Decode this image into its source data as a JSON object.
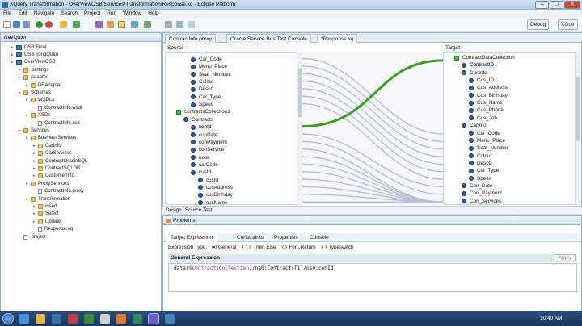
{
  "window": {
    "title": "XQuery Transformation - OverViewOSB/Services/Transformation/Response.xq - Eclipse Platform",
    "min": "–",
    "max": "□",
    "close": "X"
  },
  "menu": [
    "File",
    "Edit",
    "Navigate",
    "Search",
    "Project",
    "Run",
    "Window",
    "Help"
  ],
  "perspectives": {
    "debug": "Debug",
    "xquery": "XQue"
  },
  "navigator": {
    "tab": "Navigator",
    "items": [
      {
        "label": "OSB Final",
        "icon": "project"
      },
      {
        "label": "OSB TongQuan",
        "icon": "project"
      },
      {
        "label": "OverViewOSB",
        "icon": "project"
      },
      {
        "label": ".settings",
        "icon": "folder"
      },
      {
        "label": "Adapter",
        "icon": "folder"
      },
      {
        "label": "DBAdapter",
        "icon": "folder"
      },
      {
        "label": "Schemas",
        "icon": "folder"
      },
      {
        "label": "WSDLs",
        "icon": "folder"
      },
      {
        "label": "ContractInfo.wsdl",
        "icon": "file"
      },
      {
        "label": "XSDs",
        "icon": "folder"
      },
      {
        "label": "ContractInfo.xsd",
        "icon": "file"
      },
      {
        "label": "Services",
        "icon": "folder"
      },
      {
        "label": "BusinessServices",
        "icon": "folder"
      },
      {
        "label": "CarInfo",
        "icon": "folder"
      },
      {
        "label": "CarServices",
        "icon": "folder"
      },
      {
        "label": "ContractOracleSQL",
        "icon": "folder"
      },
      {
        "label": "ContractSQLDB",
        "icon": "folder"
      },
      {
        "label": "CustomerInfo",
        "icon": "folder"
      },
      {
        "label": "ProxyServices",
        "icon": "folder"
      },
      {
        "label": "ContractInfo.proxy",
        "icon": "file"
      },
      {
        "label": "Transformation",
        "icon": "folder"
      },
      {
        "label": "insert",
        "icon": "folder"
      },
      {
        "label": "Select",
        "icon": "folder"
      },
      {
        "label": "Update",
        "icon": "folder"
      },
      {
        "label": "Response.xq",
        "icon": "file"
      },
      {
        "label": ".project",
        "icon": "file"
      }
    ]
  },
  "editor": {
    "tabs": [
      "ContractInfo.proxy",
      "Oracle Service Bus Test Console",
      "*Response.xq"
    ],
    "source_title": "Source",
    "target_title": "Target",
    "source_nodes": [
      "Car_Code",
      "Menu_Place",
      "Seat_Number",
      "Colour",
      "DescC",
      "Car_Type",
      "Speed",
      "contractsCollection1",
      "Contracts",
      "conId",
      "conDate",
      "conPayment",
      "conService",
      "note",
      "carCode",
      "cusId",
      "cusId",
      "cusAddress",
      "cusBirthday",
      "cusName"
    ],
    "target_nodes": [
      "ContractDataCollection",
      "ContractID",
      "CusInfo",
      "Cus_ID",
      "Cus_Address",
      "Cus_Birthday",
      "Cus_Name",
      "Cus_Phone",
      "Cus_Job",
      "CarInfo",
      "Car_Code",
      "Menu_Place",
      "Seat_Number",
      "Colour",
      "DescC",
      "Car_Type",
      "Speed",
      "Con_Date",
      "Con_Payment",
      "Con_Services"
    ],
    "bottom_tabs": [
      "Design",
      "Source",
      "Test"
    ]
  },
  "panel": {
    "problems_tab": "Problems",
    "tabs": [
      "Target Expression",
      "Constraints",
      "Properties",
      "Console"
    ],
    "expression_type_label": "Expression Type:",
    "types": [
      "General",
      "If Then Else",
      "For...Return",
      "Typeswitch"
    ],
    "section": "General Expression",
    "apply": "Apply",
    "expr_prefix": "data(",
    "expr_var": "$contractsCollection1",
    "expr_rest": "/ns0:Contracts[1]/ns0:conId)"
  },
  "taskbar": {
    "time": "10:40 AM"
  },
  "colors": {
    "link_active": "#3a9d23",
    "link_inactive": "#b9bfd6",
    "node": "#2d57a3"
  }
}
